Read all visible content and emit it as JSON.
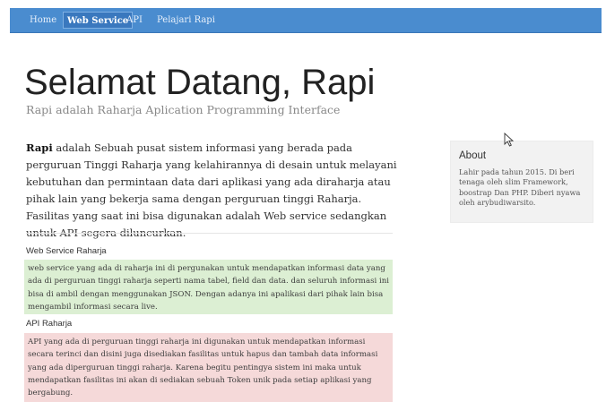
{
  "nav": {
    "items": [
      {
        "label": "Home",
        "active": false
      },
      {
        "label": "Web Service",
        "active": true
      },
      {
        "label": "API",
        "active": false
      },
      {
        "label": "Pelajari Rapi",
        "active": false
      }
    ]
  },
  "hero": {
    "title": "Selamat Datang, Rapi",
    "subtitle": "Rapi adalah Raharja Aplication Programming Interface"
  },
  "intro": {
    "bold": "Rapi",
    "text": " adalah Sebuah pusat sistem informasi yang berada pada perguruan Tinggi Raharja yang kelahirannya di desain untuk melayani kebutuhan dan permintaan data dari aplikasi yang ada diraharja atau pihak lain yang bekerja sama dengan perguruan tinggi Raharja. Fasilitas yang saat ini bisa digunakan adalah Web service sedangkan untuk API segera diluncurkan."
  },
  "sections": {
    "web_service": {
      "title": "Web Service Raharja",
      "body": "web service yang ada di raharja ini di pergunakan untuk mendapatkan informasi data yang ada di perguruan tinggi raharja seperti nama tabel, field dan data. dan seluruh informasi ini bisa di ambil dengan menggunakan JSON. Dengan adanya ini apalikasi dari pihak lain bisa mengambil informasi secara live."
    },
    "api": {
      "title": "API Raharja",
      "body": "API yang ada di perguruan tinggi raharja ini digunakan untuk mendapatkan informasi secara terinci dan disini juga disediakan fasilitas untuk hapus dan tambah data informasi yang ada diperguruan tinggi raharja. Karena begitu pentingya sistem ini maka untuk mendapatkan fasilitas ini akan di sediakan sebuah Token unik pada setiap aplikasi yang bergabung."
    }
  },
  "about": {
    "title": "About",
    "text": "Lahir pada tahun 2015. Di beri tenaga oleh slim Framework, boostrap Dan PHP. Diberi nyawa oleh arybudiwarsito."
  },
  "colors": {
    "navbar": "#4a8ccf",
    "success_panel": "#dcefd3",
    "danger_panel": "#f5d9d9"
  }
}
